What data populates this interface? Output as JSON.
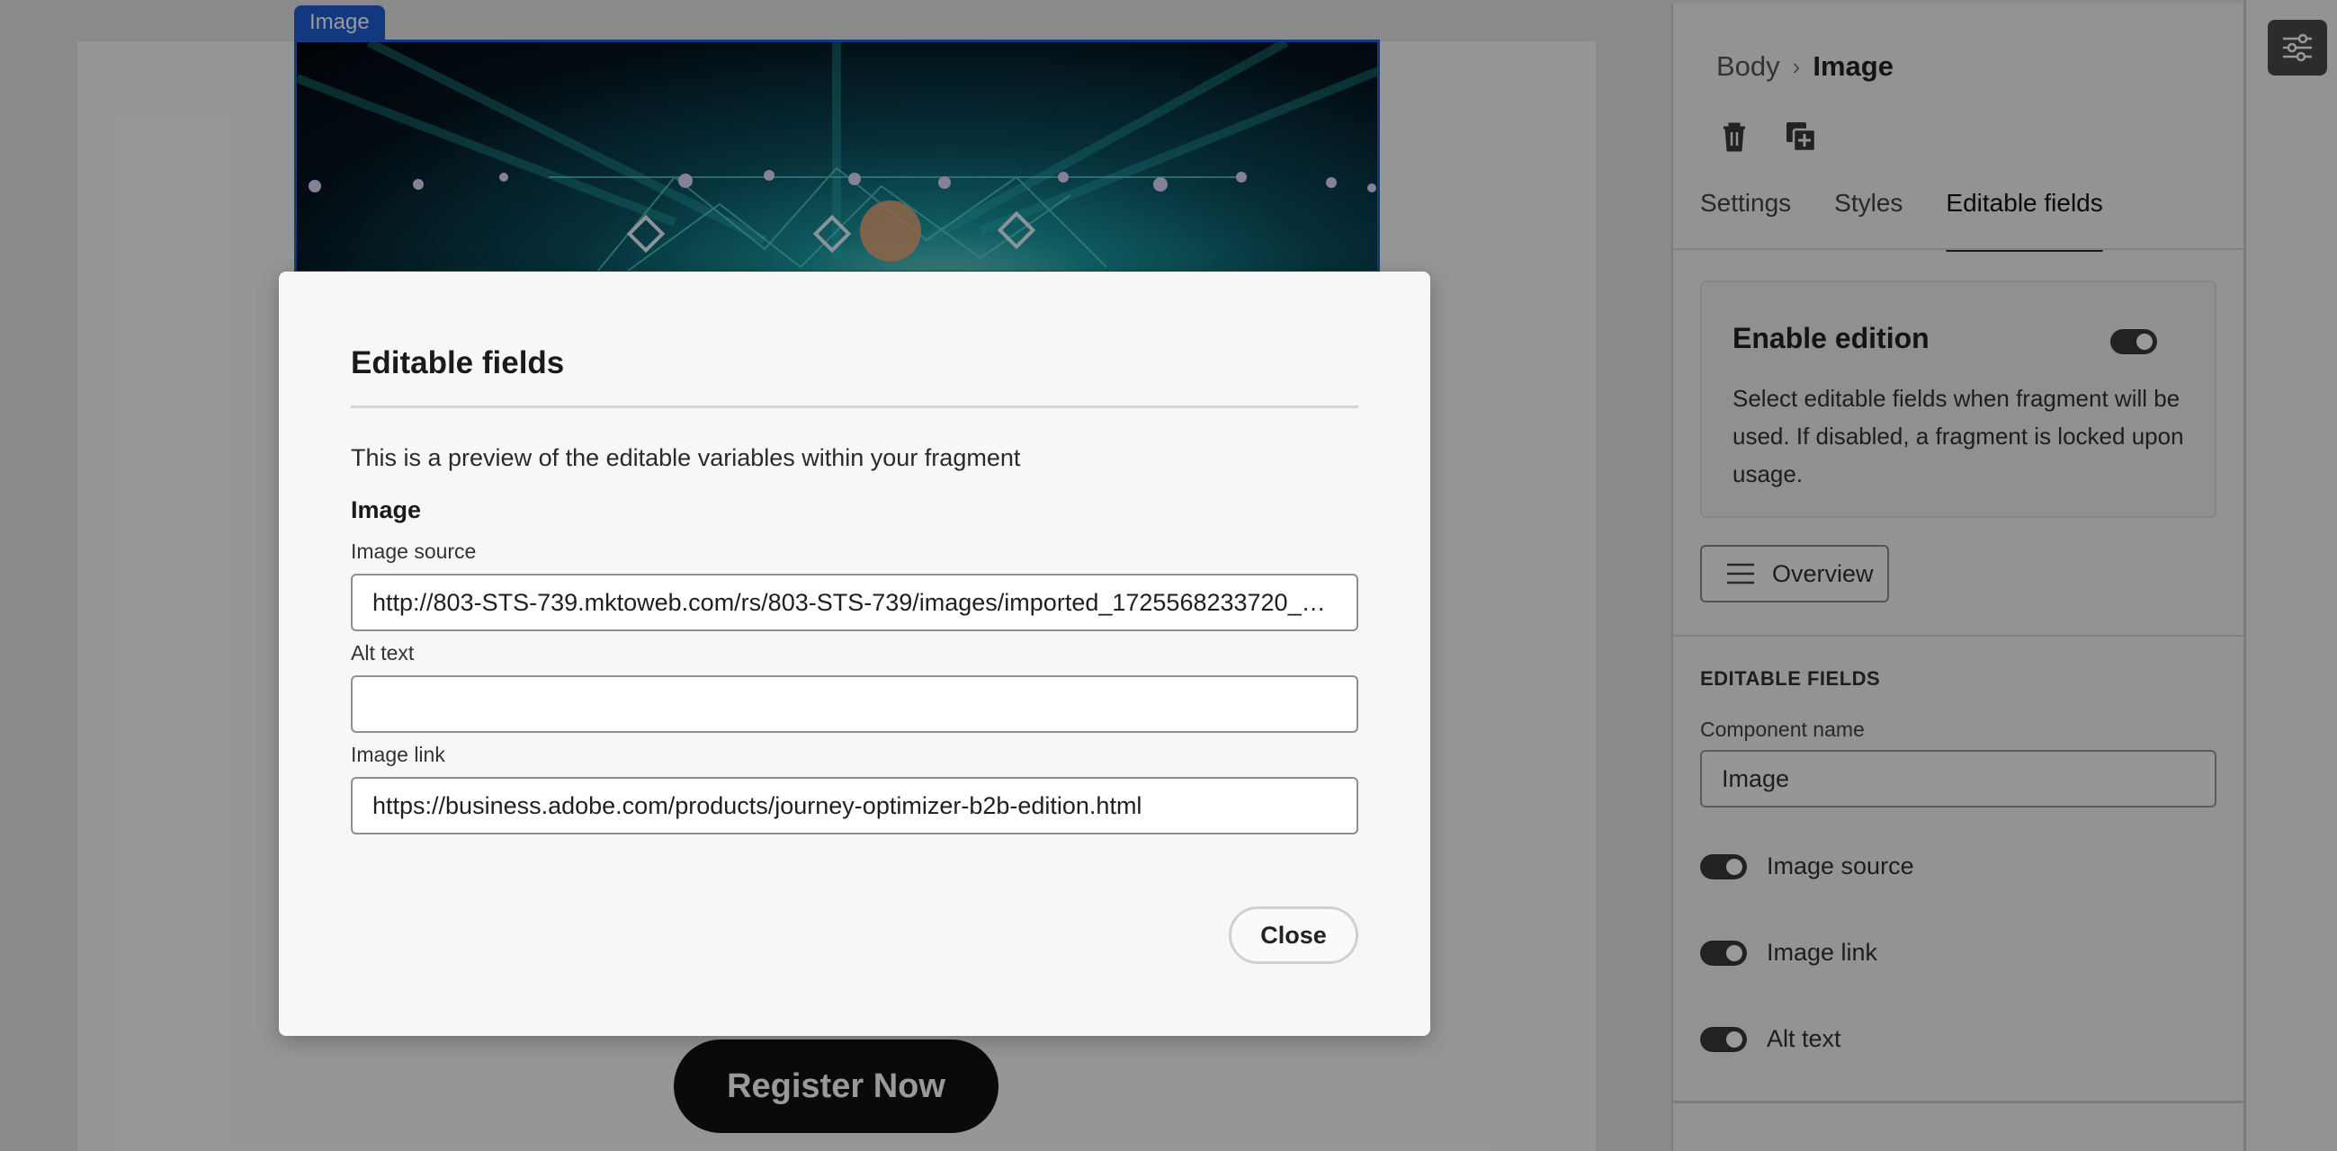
{
  "canvas": {
    "image_label": "Image",
    "register_button": "Register Now"
  },
  "panel": {
    "breadcrumb": {
      "parent": "Body",
      "current": "Image"
    },
    "tools": {
      "delete_icon": "trash-icon",
      "duplicate_icon": "duplicate-icon"
    },
    "tabs": [
      {
        "label": "Settings",
        "active": false
      },
      {
        "label": "Styles",
        "active": false
      },
      {
        "label": "Editable fields",
        "active": true
      }
    ],
    "enable_edition": {
      "title": "Enable edition",
      "description": "Select editable fields when fragment will be used. If disabled, a fragment is locked upon usage.",
      "enabled": true
    },
    "overview_button": "Overview",
    "editable_fields_heading": "EDITABLE FIELDS",
    "component_name_label": "Component name",
    "component_name_value": "Image",
    "toggles": [
      {
        "label": "Image source",
        "enabled": true
      },
      {
        "label": "Image link",
        "enabled": true
      },
      {
        "label": "Alt text",
        "enabled": true
      }
    ],
    "properties_icon": "sliders-icon"
  },
  "modal": {
    "title": "Editable fields",
    "description": "This is a preview of the editable variables within your fragment",
    "section": "Image",
    "fields": [
      {
        "label": "Image source",
        "value": "http://803-STS-739.mktoweb.com/rs/803-STS-739/images/imported_1725568233720_Adobe…"
      },
      {
        "label": "Alt text",
        "value": ""
      },
      {
        "label": "Image link",
        "value": "https://business.adobe.com/products/journey-optimizer-b2b-edition.html"
      }
    ],
    "close_button": "Close"
  }
}
